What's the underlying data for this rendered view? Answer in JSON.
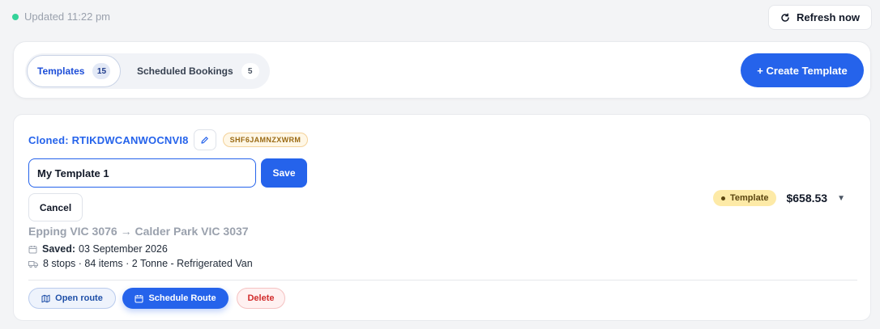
{
  "status": {
    "updated_text": "Updated 11:22 pm",
    "dot_color": "#34d399"
  },
  "refresh": {
    "label": "Refresh now",
    "icon": "refresh-icon"
  },
  "tabs": [
    {
      "label": "Templates",
      "count": "15",
      "active": true
    },
    {
      "label": "Scheduled Bookings",
      "count": "5",
      "active": false
    }
  ],
  "create_button": {
    "label": "+ Create Template"
  },
  "template": {
    "name": "Cloned: RTIKDWCANWOCNVI8",
    "code": "SHF6JAMNZXWRM",
    "name_input_value": "My Template 1",
    "save_label": "Save",
    "cancel_label": "Cancel",
    "route": "Epping VIC 3076 → Calder Park VIC 3037",
    "saved_label": "Saved:",
    "saved_date": "03 September 2026",
    "details": "8 stops · 84 items · 2 Tonne - Refrigerated Van",
    "badge": "Template",
    "price": "$658.53",
    "actions": {
      "open_route": "Open route",
      "schedule_route": "Schedule Route",
      "delete": "Delete"
    }
  },
  "colors": {
    "accent": "#2563eb",
    "badge_bg": "#fdeaa7",
    "delete_text": "#d12c2c",
    "code_badge_bg": "#fff7e6"
  }
}
